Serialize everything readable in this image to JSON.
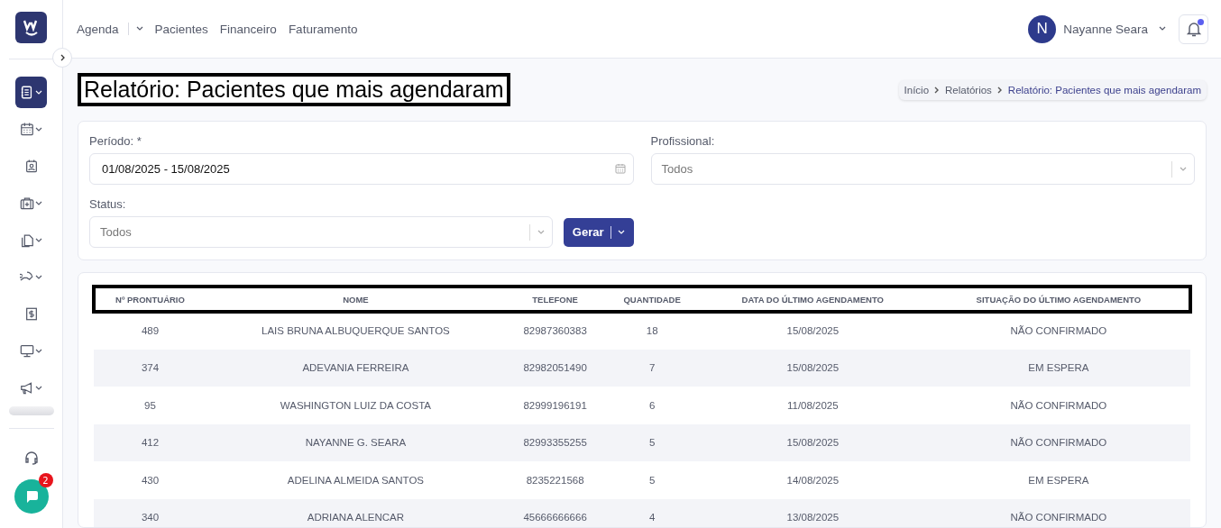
{
  "sidebar": {
    "items": [
      {
        "kind": "notebook",
        "has_menu": true,
        "selected": true
      },
      {
        "kind": "calendar",
        "has_menu": true,
        "selected": false
      },
      {
        "kind": "badge",
        "has_menu": false,
        "selected": false
      },
      {
        "kind": "medkit",
        "has_menu": true,
        "selected": false
      },
      {
        "kind": "documents",
        "has_menu": true,
        "selected": false
      },
      {
        "kind": "hand",
        "has_menu": true,
        "selected": false
      },
      {
        "kind": "receipt",
        "has_menu": false,
        "selected": false
      },
      {
        "kind": "monitor",
        "has_menu": true,
        "selected": false
      },
      {
        "kind": "megaphone",
        "has_menu": true,
        "selected": false
      }
    ],
    "chat_badge": "2"
  },
  "nav": [
    {
      "label": "Agenda",
      "has_menu": true
    },
    {
      "label": "Pacientes",
      "has_menu": false
    },
    {
      "label": "Financeiro",
      "has_menu": false
    },
    {
      "label": "Faturamento",
      "has_menu": false
    }
  ],
  "user": {
    "initial": "N",
    "name": "Nayanne Seara"
  },
  "notifications": {
    "unread": true
  },
  "page_title": "Relatório: Pacientes que mais agendaram",
  "breadcrumb": [
    "Início",
    "Relatórios",
    "Relatório: Pacientes que mais agendaram"
  ],
  "filters": {
    "period": {
      "label": "Período: *",
      "value": "01/08/2025 - 15/08/2025"
    },
    "professional": {
      "label": "Profissional:",
      "placeholder": "Todos"
    },
    "status": {
      "label": "Status:",
      "placeholder": "Todos"
    },
    "generate": "Gerar"
  },
  "table": {
    "columns": [
      "Nº PRONTUÁRIO",
      "NOME",
      "TELEFONE",
      "QUANTIDADE",
      "DATA DO ÚLTIMO AGENDAMENTO",
      "SITUAÇÃO DO ÚLTIMO AGENDAMENTO"
    ],
    "rows": [
      [
        "489",
        "LAIS BRUNA ALBUQUERQUE SANTOS",
        "82987360383",
        "18",
        "15/08/2025",
        "NÃO CONFIRMADO"
      ],
      [
        "374",
        "ADEVANIA FERREIRA",
        "82982051490",
        "7",
        "15/08/2025",
        "EM ESPERA"
      ],
      [
        "95",
        "WASHINGTON LUIZ DA COSTA",
        "82999196191",
        "6",
        "11/08/2025",
        "NÃO CONFIRMADO"
      ],
      [
        "412",
        "NAYANNE G. SEARA",
        "82993355255",
        "5",
        "15/08/2025",
        "NÃO CONFIRMADO"
      ],
      [
        "430",
        "ADELINA ALMEIDA SANTOS",
        "8235221568",
        "5",
        "14/08/2025",
        "EM ESPERA"
      ],
      [
        "340",
        "ADRIANA ALENCAR",
        "45666666666",
        "4",
        "13/08/2025",
        "NÃO CONFIRMADO"
      ]
    ]
  }
}
